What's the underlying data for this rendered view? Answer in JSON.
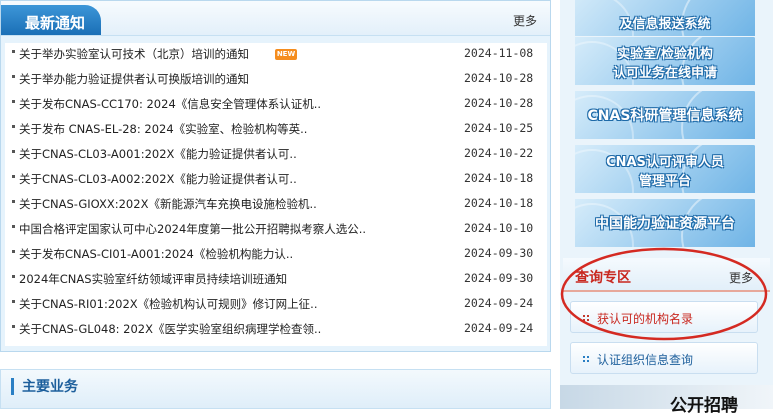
{
  "notices": {
    "title": "最新通知",
    "more_label": "更多",
    "new_badge": "NEW",
    "items": [
      {
        "title": "关于举办实验室认可技术（北京）培训的通知",
        "date": "2024-11-08",
        "is_new": true
      },
      {
        "title": "关于举办能力验证提供者认可换版培训的通知",
        "date": "2024-10-28"
      },
      {
        "title": "关于发布CNAS-CC170: 2024《信息安全管理体系认证机..",
        "date": "2024-10-28"
      },
      {
        "title": "关于发布 CNAS-EL-28: 2024《实验室、检验机构等英..",
        "date": "2024-10-25"
      },
      {
        "title": "关于CNAS-CL03-A001:202X《能力验证提供者认可..",
        "date": "2024-10-22"
      },
      {
        "title": "关于CNAS-CL03-A002:202X《能力验证提供者认可..",
        "date": "2024-10-18"
      },
      {
        "title": "关于CNAS-GIOXX:202X《新能源汽车充换电设施检验机..",
        "date": "2024-10-18"
      },
      {
        "title": "中国合格评定国家认可中心2024年度第一批公开招聘拟考察人选公..",
        "date": "2024-10-10"
      },
      {
        "title": "关于发布CNAS-CI01-A001:2024《检验机构能力认..",
        "date": "2024-09-30"
      },
      {
        "title": "2024年CNAS实验室纤纺领域评审员持续培训班通知",
        "date": "2024-09-30"
      },
      {
        "title": "关于CNAS-RI01:202X《检验机构认可规则》修订网上征..",
        "date": "2024-09-24"
      },
      {
        "title": "关于CNAS-GL048: 202X《医学实验室组织病理学检查领..",
        "date": "2024-09-24"
      }
    ]
  },
  "main_business": {
    "title": "主要业务"
  },
  "sidebar": {
    "banners": [
      {
        "line1": "",
        "line2": "及信息报送系统"
      },
      {
        "line1": "实验室/检验机构",
        "line2": "认可业务在线申请"
      },
      {
        "line1": "CNAS科研管理信息系统",
        "line2": ""
      },
      {
        "line1": "CNAS认可评审人员",
        "line2": "管理平台"
      },
      {
        "line1": "中国能力验证资源平台",
        "line2": ""
      }
    ],
    "query": {
      "title": "查询专区",
      "more_label": "更多",
      "buttons": [
        "获认可的机构名录",
        "认证组织信息查询"
      ]
    },
    "recruit_text": "公开招聘"
  },
  "colors": {
    "accent": "#1a6fb6",
    "highlight_red": "#d42a22",
    "page_bg": "#e6f3fc"
  }
}
